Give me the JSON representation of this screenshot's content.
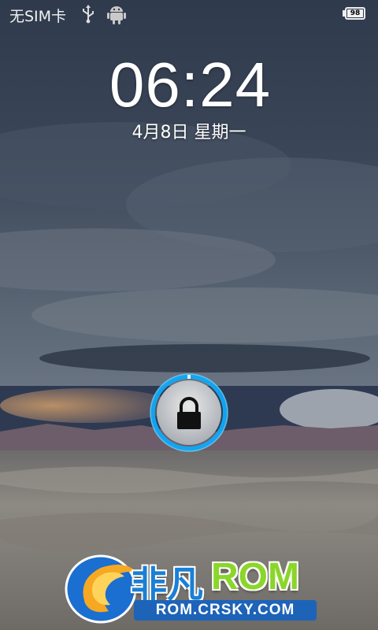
{
  "status_bar": {
    "sim_text": "无SIM卡",
    "usb_icon": "usb-icon",
    "debug_icon": "android-debug-icon",
    "battery_level": "98"
  },
  "lockscreen": {
    "time": "06:24",
    "date": "4月8日 星期一",
    "lock_icon": "padlock-icon",
    "ring_color": "#19a6f2"
  },
  "watermark": {
    "title_cn": "非凡",
    "title_en": "ROM",
    "url": "ROM.CRSKY.COM"
  }
}
